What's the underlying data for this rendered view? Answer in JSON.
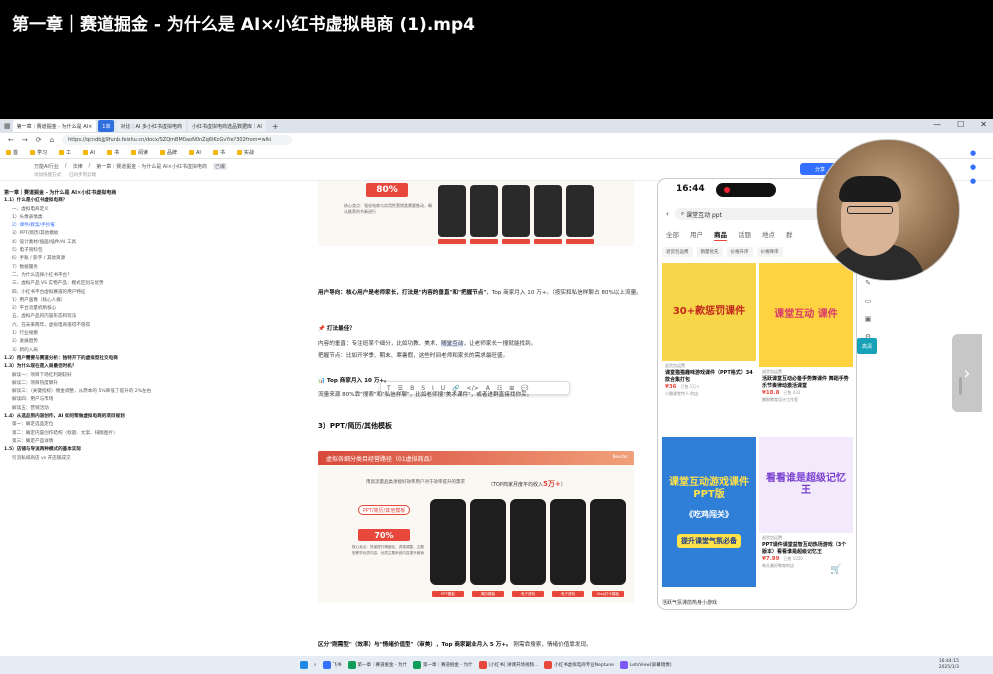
{
  "video": {
    "title": "第一章｜赛道掘金 - 为什么是 AI×小红书虚拟电商 (1).mp4"
  },
  "browser": {
    "tabs": [
      {
        "label": "第一章｜赛道掘金 - 为什么是 AI×",
        "active": true,
        "pill": false
      },
      {
        "label": "1单",
        "active": false,
        "pill": true
      },
      {
        "label": "对比｜AI 多小红书虚拟电商",
        "active": false,
        "pill": false
      },
      {
        "label": "小红书虚拟电商选品数据库｜AI",
        "active": false,
        "pill": false
      }
    ],
    "url": "https://qcndbjjj9funb.feishu.cn/docx/SZQmBM0aoN0nZq6lKcGvYie?302from=wiki",
    "bookmarks": [
      "首",
      "学习",
      "工",
      "AI",
      "书",
      "阅读",
      "品牌",
      "AI",
      "书",
      "实战"
    ]
  },
  "doc_header": {
    "crumbs": [
      "万能AI行业",
      "法律",
      "第一章｜赛道掘金 - 为什么是 AI×小红书虚拟电商"
    ],
    "tag": "已编",
    "sub": [
      "添加快捷方式",
      "已同步到云端"
    ],
    "share": "分享"
  },
  "outline": [
    {
      "text": "第一章｜赛道掘金 - 为什么是 AI×小红书虚拟电商",
      "level": "h1"
    },
    {
      "text": "1.1）什么是小红书虚拟电商？",
      "level": "h2"
    },
    {
      "text": "一、虚拟电商定义",
      "level": "n"
    },
    {
      "text": "1）头像表情类",
      "level": "n"
    },
    {
      "text": "2）课件/教案/手抄报",
      "level": "a"
    },
    {
      "text": "3）PPT/简历/其他模板",
      "level": "n"
    },
    {
      "text": "4）设计素材/插画/插件/AI 工具",
      "level": "n"
    },
    {
      "text": "5）电子资料包",
      "level": "n"
    },
    {
      "text": "6）手账 / 影字 / 其他资源",
      "level": "n"
    },
    {
      "text": "7）数据服务",
      "level": "n"
    },
    {
      "text": "二、为什么选择小红书平台？",
      "level": "n"
    },
    {
      "text": "三、虚拟产品 VS 实物产品：模式区别与优势",
      "level": "n"
    },
    {
      "text": "四、小红书平台虚拟赛道的用户特征",
      "level": "n"
    },
    {
      "text": "1）用户画像（核心人群）",
      "level": "n"
    },
    {
      "text": "2）平台流量机制核心",
      "level": "n"
    },
    {
      "text": "五、虚拟产品的内容形态和玩法",
      "level": "n"
    },
    {
      "text": "六、在未来两年，虚拟电商值得不值得",
      "level": "n"
    },
    {
      "text": "1）行业规模",
      "level": "n"
    },
    {
      "text": "2）发展趋势",
      "level": "n"
    },
    {
      "text": "3）新的入局",
      "level": "n"
    },
    {
      "text": "1.2）用户需要与赛道分析：独特开下的虚拟型社交电商",
      "level": "h2"
    },
    {
      "text": "1.3）为什么现在是入局最佳时机？",
      "level": "h2"
    },
    {
      "text": "解读一：项目下场红利期较好",
      "level": "n"
    },
    {
      "text": "解读二：项目热度攀升",
      "level": "n"
    },
    {
      "text": "解读三：（关键指标）佣金调整，从原本的 5%降低了提升的 2%左右",
      "level": "n"
    },
    {
      "text": "解读四：用户与市场",
      "level": "n"
    },
    {
      "text": "解读五：营销活动",
      "level": "n"
    },
    {
      "text": "1.4）从选品到内容创作，AI 如何帮做虚拟电商的项目规划",
      "level": "h2"
    },
    {
      "text": "第一：确定选品定位",
      "level": "n"
    },
    {
      "text": "第二：确定内容创作结构（标题、文案、排版图片）",
      "level": "n"
    },
    {
      "text": "第三：确定产品详情",
      "level": "n"
    },
    {
      "text": "1.5）店铺与导流两种模式的基本实际",
      "level": "h2"
    },
    {
      "text": "引流私域商店 vs 开店铺成交",
      "level": "n"
    }
  ],
  "doc": {
    "img1": {
      "badge": "80%",
      "note": "核心卖点：强化电商与实用性营销类需要推动，确认推荐的节奏进行",
      "labels": [
        "证件照片",
        "证件照片",
        "证件照片",
        "证件照片",
        "证件照片"
      ]
    },
    "p1_bold": "用户导向：核心用户是老师家长，打法是\"内容的垂直\"和\"把握节点\"",
    "p1_rest": "，Top 商家月入 10 万+。（按实和私信样聊占 80%以上流量。",
    "h_play": "📌 打法最佳？",
    "toolbar": [
      "T",
      "☰",
      "B",
      "S",
      "I",
      "U",
      "🔗",
      "</>",
      "A",
      "☷",
      "⊞",
      "💬"
    ],
    "p2_pre": "内容的垂直：专注班某个细分，比如功教、美术、",
    "p2_hl": "随堂互动",
    "p2_post": "，让老师家长一搜就能找到。",
    "p3": "把握节点：比如开学季、期末、寒暑假，这些时间老师和家长的需求最旺盛。",
    "h_top": "📊 Top 商家月入 10 万+。",
    "p4": "流量来源 80%靠\"搜索\"和\"私信样聊\"，比如老师搜\"美术课件\"，或者进群直接找你买。",
    "h3": "3）PPT/简历/其他模板",
    "img2": {
      "title": "虚拟各细分类目经营路径（01虚拟商品）",
      "brand": "Nexstar",
      "sub": "用高流量品类承接好效率用户对于效率提升的需求",
      "target_pre": "（TOP商家月度平均收入",
      "target_val": "5万+",
      "target_post": "）",
      "ppt": "PPT/简历/其他模板",
      "pct": "70%",
      "note": "核心卖点：抓道提升精细化、资源调整、主题型教学优质内容、优质主题系统内容提升营销",
      "labels": [
        "PPT模板",
        "简历模板",
        "电子资料",
        "电子资料",
        "Vlog打卡模板"
      ]
    },
    "p5_bold": "区分\"刚需型\"（效率）与\"情绪价值型\"（审美），Top 商家副业月入 5 万+。",
    "p5_rest": " 刚需靠搜索，情绪价值靠发现。"
  },
  "phone": {
    "time": "16:44",
    "search": "课堂互动 ppt",
    "tabs": [
      "全部",
      "用户",
      "商品",
      "话题",
      "地点",
      "群"
    ],
    "active_tab": "商品",
    "filters": [
      "退货包运费",
      "销量优先",
      "价格升序",
      "价格降序"
    ],
    "cards": [
      {
        "img_text": "30+款惩罚课件",
        "img_bg": "#f7d64a",
        "img_color": "#c2261c",
        "tag": "退货包运费",
        "title": "课堂猫猫趣味游戏课件（PPT格式）34款合集打包",
        "price": "¥36",
        "sold": "已售 1万+",
        "shop": "小猫课堂传人 的店"
      },
      {
        "img_text": "课堂互动 课件",
        "img_bg": "#ffd23f",
        "img_color": "#d93b6a",
        "tag": "退货包运费",
        "title": "活跃课堂互动必备手势舞课件 舞蹈手势乐节奏律动激活课堂",
        "price": "¥18.8",
        "sold": "已售 433",
        "shop": "懒狗教育设计工作室"
      },
      {
        "img_text": "课堂互动游戏课件 PPT版",
        "img_bg": "#2f7fd8",
        "img_color": "#ffe14a",
        "tag": "",
        "title": "",
        "price": "",
        "sold": "",
        "shop": ""
      },
      {
        "img_text": "看看谁是超级记忆王",
        "img_bg": "#f2eafb",
        "img_color": "#7a3fd1",
        "tag": "退货包运费",
        "title": "PPT课件课堂益智互动热场游戏（3个版本）看看谁是超级记忆王",
        "price": "¥7.99",
        "sold": "已售 1050",
        "shop": "每天美好教育的店"
      }
    ],
    "card3_caption": "《吃鸡闯关》",
    "card3_banner": "提升课堂气氛必备",
    "bottom_left": "活跃气氛课前热身小游戏"
  },
  "right_tools": {
    "hd": "高清"
  },
  "taskbar": {
    "items": [
      "飞书",
      "第一章｜赛道掘金 - 为什",
      "第一章｜赛道掘金 - 为什",
      "[小红书] 讲课开场视频...",
      "小红书虚拟电商专业Neptune",
      "LetsView[屏幕镜像]"
    ],
    "time": "16:44:15",
    "date": "2025/1/3"
  }
}
